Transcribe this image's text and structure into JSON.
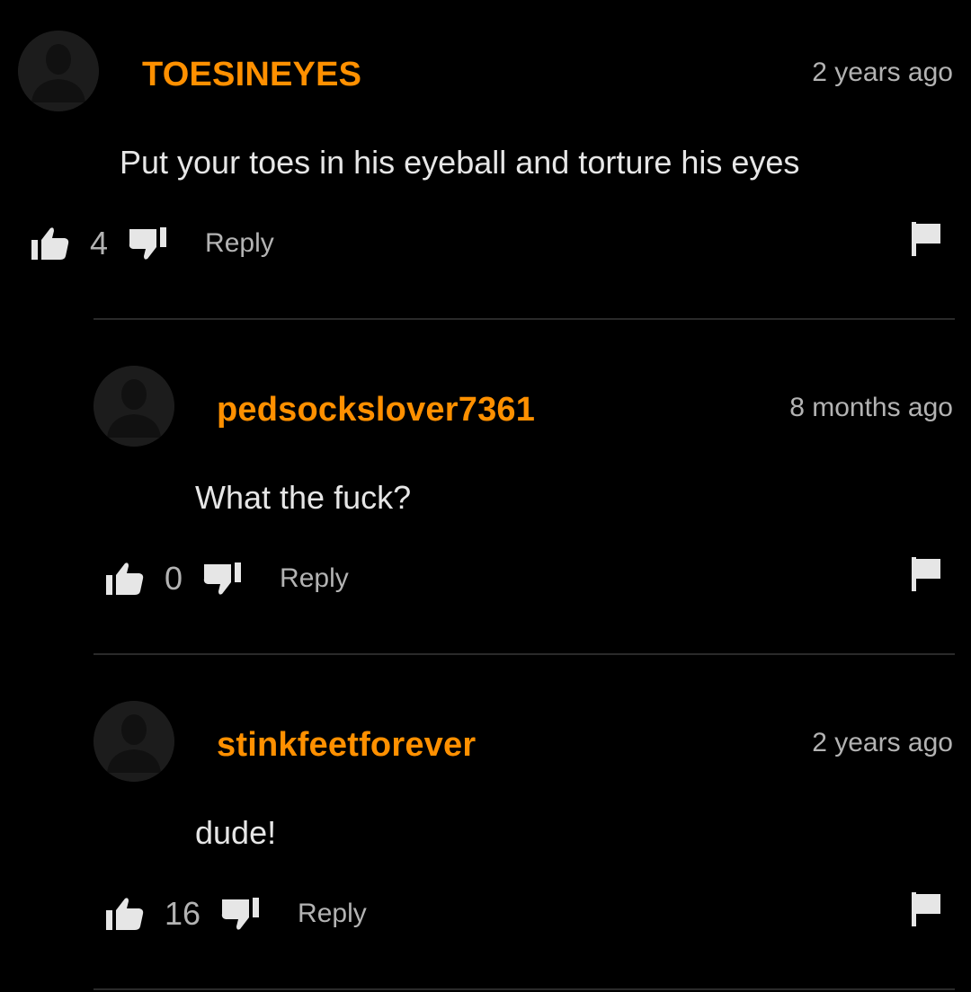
{
  "comments": [
    {
      "username": "TOESINEYES",
      "timestamp": "2 years ago",
      "text": "Put your toes in his eyeball and torture his eyes",
      "votes": "4",
      "reply_label": "Reply"
    },
    {
      "username": "pedsockslover7361",
      "timestamp": "8 months ago",
      "text": "What the fuck?",
      "votes": "0",
      "reply_label": "Reply"
    },
    {
      "username": "stinkfeetforever",
      "timestamp": "2 years ago",
      "text": "dude!",
      "votes": "16",
      "reply_label": "Reply"
    }
  ],
  "colors": {
    "background": "#000000",
    "username": "#ff9000",
    "text": "#e6e6e6",
    "muted": "#b3b3b3",
    "divider": "#2a2a2a",
    "avatar": "#1c1c1c"
  },
  "icons": {
    "avatar": "default-user-avatar-icon",
    "upvote": "thumbs-up-icon",
    "downvote": "thumbs-down-icon",
    "flag": "flag-icon"
  }
}
